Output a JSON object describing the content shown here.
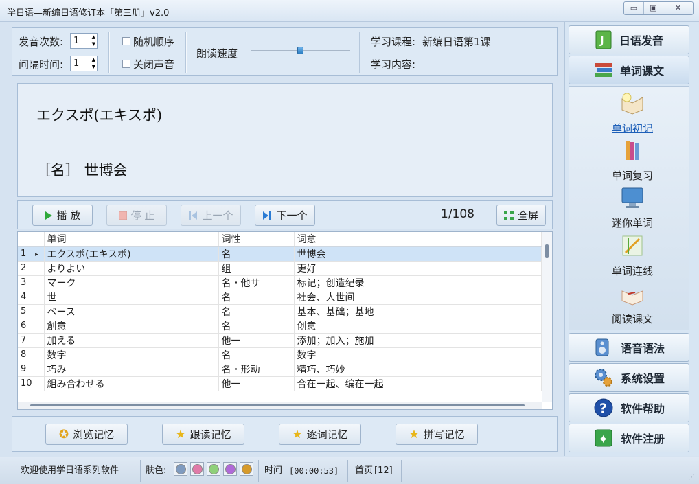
{
  "app": {
    "title": "学日语—新编日语修订本「第三册」v2.0"
  },
  "window_buttons": {
    "minimize": "▭",
    "maximize": "▣",
    "close": "✕"
  },
  "settings": {
    "repeat_label": "发音次数:",
    "repeat_value": "1",
    "interval_label": "间隔时间:",
    "interval_value": "1",
    "random_order": "随机顺序",
    "mute_sound": "关闭声音",
    "speed_label": "朗读速度",
    "speed_level": 0.5,
    "course_label": "学习课程:",
    "course_value": "新编日语第1课",
    "content_label": "学习内容:",
    "content_value": ""
  },
  "word_display": {
    "reading": "エクスポ(エキスポ)",
    "meaning": "［名］ 世博会"
  },
  "controls": {
    "play": "播 放",
    "stop": "停 止",
    "prev": "上一个",
    "next": "下一个",
    "counter": "1/108",
    "fullscreen": "全屏"
  },
  "table": {
    "headers": [
      "单词",
      "词性",
      "词意"
    ],
    "rows": [
      {
        "n": "1",
        "word": "エクスポ(エキスポ)",
        "pos": "名",
        "meaning": "世博会"
      },
      {
        "n": "2",
        "word": "よりよい",
        "pos": "组",
        "meaning": "更好"
      },
      {
        "n": "3",
        "word": "マーク",
        "pos": "名・他サ",
        "meaning": "标记；创造纪录"
      },
      {
        "n": "4",
        "word": "世",
        "pos": "名",
        "meaning": "社会、人世间"
      },
      {
        "n": "5",
        "word": "ベース",
        "pos": "名",
        "meaning": "基本、基础；基地"
      },
      {
        "n": "6",
        "word": "創意",
        "pos": "名",
        "meaning": "创意"
      },
      {
        "n": "7",
        "word": "加える",
        "pos": "他一",
        "meaning": "添加；加入；施加"
      },
      {
        "n": "8",
        "word": "数字",
        "pos": "名",
        "meaning": "数字"
      },
      {
        "n": "9",
        "word": "巧み",
        "pos": "名・形动",
        "meaning": "精巧、巧妙"
      },
      {
        "n": "10",
        "word": "組み合わせる",
        "pos": "他一",
        "meaning": "合在一起、编在一起"
      }
    ]
  },
  "memory": {
    "browse": "浏览记忆",
    "follow": "跟读记忆",
    "word_by_word": "逐词记忆",
    "spelling": "拼写记忆"
  },
  "nav": {
    "pronunciation": "日语发音",
    "vocab": "单词课文",
    "sub": [
      "单词初记",
      "单词复习",
      "迷你单词",
      "单词连线",
      "阅读课文"
    ],
    "grammar": "语音语法",
    "settings": "系统设置",
    "help": "软件帮助",
    "register": "软件注册"
  },
  "status": {
    "welcome": "欢迎使用学日语系列软件",
    "skin_label": "肤色:",
    "skin_colors": [
      "#7f9bbf",
      "#e07aa8",
      "#8fd07a",
      "#b06ad8",
      "#d69a2a"
    ],
    "time_label": "时间",
    "time_value": "[00:00:53]",
    "page_label": "首页",
    "page_value": "[12]"
  }
}
